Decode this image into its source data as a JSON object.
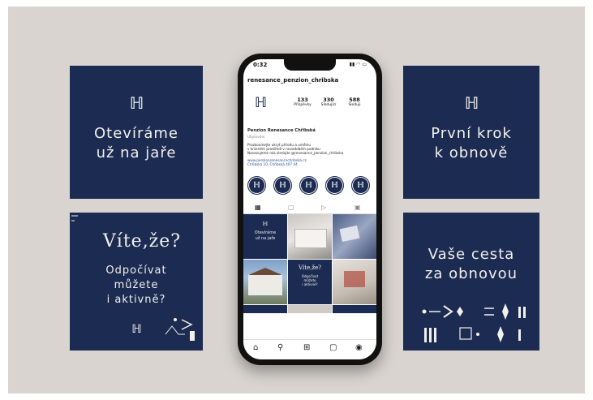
{
  "colors": {
    "navy": "#1c2b52",
    "background": "#d9d4d0",
    "text_light": "#f2f0ec"
  },
  "logo_glyph": "ℍ",
  "cards": {
    "top_left": {
      "title_1": "Otevíráme",
      "title_2": "už na jaře"
    },
    "bottom_left": {
      "headline": "Víte,že?",
      "body_1": "Odpočívat",
      "body_2": "můžete",
      "body_3": "i aktivně?"
    },
    "top_right": {
      "title_1": "První krok",
      "title_2": "k obnově"
    },
    "bottom_right": {
      "title_1": "Vaše cesta",
      "title_2": "za obnovou"
    }
  },
  "phone": {
    "status_time": "0:32",
    "status_icons": "▮▮ ◠ ▭",
    "username": "renesance_penzion_chribska",
    "stats": [
      {
        "value": "133",
        "label": "Příspěvky"
      },
      {
        "value": "330",
        "label": "Sledující"
      },
      {
        "value": "588",
        "label": "Sleduji"
      }
    ],
    "bio": {
      "name": "Penzion Renesance Chřibská",
      "category": "Ubytování",
      "line1": "Prozkoumejte ukryt přírodu a umělnu",
      "line2": "v krásném prostředí v novodobém podniku",
      "line3": "Navazujeme nás sledujte @renesance_penzion_chribska",
      "website": "www.penzionrenesancechribska.cz",
      "address": "Chřibská 10, Chřibská 407 44"
    },
    "grid_texts": {
      "cell1_line1": "Otevíráme",
      "cell1_line2": "už na jaře",
      "cell5_head": "Víte,že?",
      "cell5_l1": "Odpočívat",
      "cell5_l2": "můžete",
      "cell5_l3": "i aktivně?"
    },
    "tab_icons": [
      "grid-icon",
      "reels-icon",
      "play-icon",
      "tagged-icon"
    ],
    "nav_icons": [
      "home-icon",
      "search-icon",
      "add-icon",
      "shop-icon",
      "profile-icon"
    ]
  }
}
